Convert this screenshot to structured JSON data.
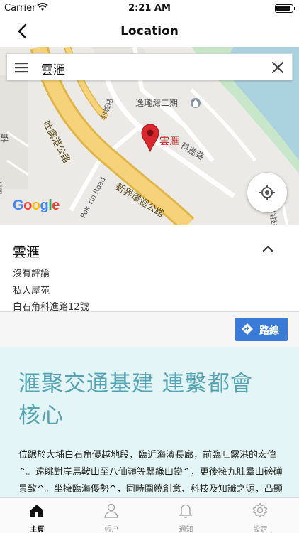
{
  "status_bar": {
    "carrier": "Carrier",
    "time": "2:21 AM"
  },
  "nav": {
    "title": "Location"
  },
  "search": {
    "query": "雲滙"
  },
  "map": {
    "labels": {
      "estate": "逸瓏灣二期",
      "pin": "雲滙",
      "hwy1": "吐露港公路",
      "hwy2": "新界環迴公路",
      "road1": "科進路",
      "road2": "科城路",
      "road3": "Pok Yin Road",
      "edge1": "學",
      "edge2": "科學",
      "edge3": "科技街"
    },
    "logo": "Google"
  },
  "place": {
    "name": "雲滙",
    "reviews": "沒有評論",
    "type": "私人屋苑",
    "address": "白石角科進路12號"
  },
  "route_button": {
    "label": "路線"
  },
  "promo": {
    "headline": "滙聚交通基建 連繫都會核心",
    "body": "位踞於大埔白石角優越地段，臨近海濱長廊，前臨吐露港的宏偉^。遠眺對岸馬鞍山至八仙嶺等翠綠山巒^，更後擁九肚羣山磅礡景致^。坐擁臨海優勢^，同時圍繞創意、科技及知識之源，凸顯智慧品味生活。"
  },
  "tabs": [
    {
      "label": "主頁",
      "icon": "home-icon",
      "active": true
    },
    {
      "label": "帳户",
      "icon": "user-icon",
      "active": false
    },
    {
      "label": "通知",
      "icon": "bell-icon",
      "active": false
    },
    {
      "label": "設定",
      "icon": "gear-icon",
      "active": false
    }
  ],
  "colors": {
    "accent": "#3b7bd8",
    "promo_bg": "#e3f5f6",
    "headline": "#57a2b3",
    "pin": "#d9272e",
    "highway": "#f6d37a"
  }
}
